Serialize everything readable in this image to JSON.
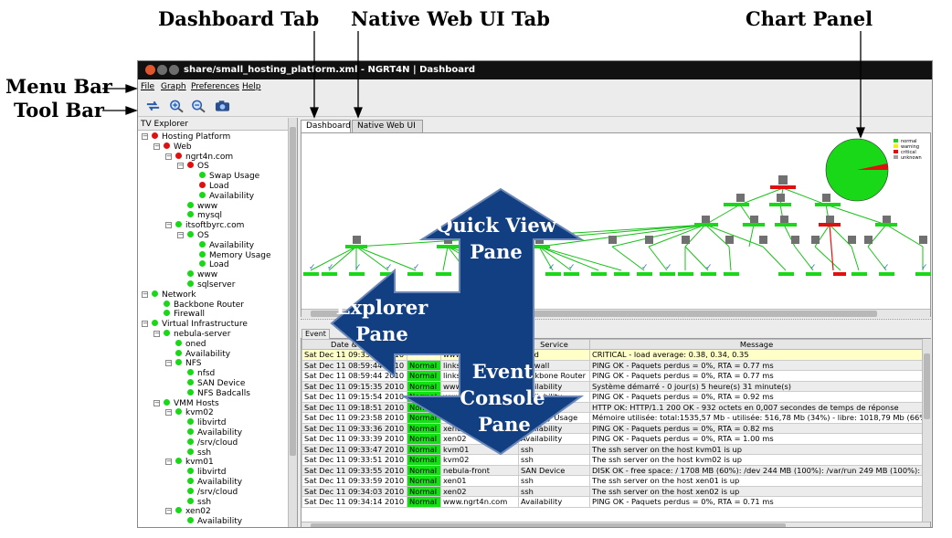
{
  "callouts": {
    "dashboard_tab": "Dashboard Tab",
    "native_tab": "Native Web UI Tab",
    "chart_panel": "Chart Panel",
    "menu_bar": "Menu Bar",
    "tool_bar": "Tool Bar",
    "quick_view": [
      "Quick View",
      "Pane"
    ],
    "explorer": [
      "Explorer",
      "Pane"
    ],
    "event_console": [
      "Event",
      "Console",
      "Pane"
    ]
  },
  "window": {
    "title": "share/small_hosting_platform.xml - NGRT4N | Dashboard"
  },
  "menu": [
    "File",
    "Graph",
    "Preferences",
    "Help"
  ],
  "toolbar_icons": [
    "refresh-icon",
    "zoom-in-icon",
    "zoom-out-icon",
    "camera-icon"
  ],
  "explorer": {
    "title": "TV Explorer",
    "tree": [
      {
        "label": "Hosting Platform",
        "level": 0,
        "status": "critical"
      },
      {
        "label": "Web",
        "level": 1,
        "status": "critical"
      },
      {
        "label": "ngrt4n.com",
        "level": 2,
        "status": "critical"
      },
      {
        "label": "OS",
        "level": 3,
        "status": "critical"
      },
      {
        "label": "Swap Usage",
        "level": 4,
        "status": "normal"
      },
      {
        "label": "Load",
        "level": 4,
        "status": "critical"
      },
      {
        "label": "Availability",
        "level": 4,
        "status": "normal"
      },
      {
        "label": "www",
        "level": 3,
        "status": "normal"
      },
      {
        "label": "mysql",
        "level": 3,
        "status": "normal"
      },
      {
        "label": "itsoftbyrc.com",
        "level": 2,
        "status": "normal"
      },
      {
        "label": "OS",
        "level": 3,
        "status": "normal"
      },
      {
        "label": "Availability",
        "level": 4,
        "status": "normal"
      },
      {
        "label": "Memory Usage",
        "level": 4,
        "status": "normal"
      },
      {
        "label": "Load",
        "level": 4,
        "status": "normal"
      },
      {
        "label": "www",
        "level": 3,
        "status": "normal"
      },
      {
        "label": "sqlserver",
        "level": 3,
        "status": "normal"
      },
      {
        "label": "Network",
        "level": 0,
        "status": "normal"
      },
      {
        "label": "Backbone Router",
        "level": 1,
        "status": "normal"
      },
      {
        "label": "Firewall",
        "level": 1,
        "status": "normal"
      },
      {
        "label": "Virtual Infrastructure",
        "level": 0,
        "status": "normal"
      },
      {
        "label": "nebula-server",
        "level": 1,
        "status": "normal"
      },
      {
        "label": "oned",
        "level": 2,
        "status": "normal"
      },
      {
        "label": "Availability",
        "level": 2,
        "status": "normal"
      },
      {
        "label": "NFS",
        "level": 2,
        "status": "normal"
      },
      {
        "label": "nfsd",
        "level": 3,
        "status": "normal"
      },
      {
        "label": "SAN Device",
        "level": 3,
        "status": "normal"
      },
      {
        "label": "NFS Badcalls",
        "level": 3,
        "status": "normal"
      },
      {
        "label": "VMM Hosts",
        "level": 1,
        "status": "normal"
      },
      {
        "label": "kvm02",
        "level": 2,
        "status": "normal"
      },
      {
        "label": "libvirtd",
        "level": 3,
        "status": "normal"
      },
      {
        "label": "Availability",
        "level": 3,
        "status": "normal"
      },
      {
        "label": "/srv/cloud",
        "level": 3,
        "status": "normal"
      },
      {
        "label": "ssh",
        "level": 3,
        "status": "normal"
      },
      {
        "label": "kvm01",
        "level": 2,
        "status": "normal"
      },
      {
        "label": "libvirtd",
        "level": 3,
        "status": "normal"
      },
      {
        "label": "Availability",
        "level": 3,
        "status": "normal"
      },
      {
        "label": "/srv/cloud",
        "level": 3,
        "status": "normal"
      },
      {
        "label": "ssh",
        "level": 3,
        "status": "normal"
      },
      {
        "label": "xen02",
        "level": 2,
        "status": "normal"
      },
      {
        "label": "Availability",
        "level": 3,
        "status": "normal"
      }
    ]
  },
  "tabs": [
    "Dashboard",
    "Native Web UI"
  ],
  "chart_legend": [
    "normal",
    "warning",
    "critical",
    "unknown"
  ],
  "status_colors": {
    "normal": "#18d818",
    "warning": "#f2f200",
    "critical": "#e01010",
    "unknown": "#a0a0a0"
  },
  "console": {
    "tab": "Event",
    "columns": [
      "Date & Time",
      "Status",
      "Host",
      "Service",
      "Message"
    ],
    "rows": [
      {
        "date": "Sat Dec 11 09:33:52 2010",
        "status": "Critical",
        "host": "www.ngrt4n.com",
        "service": "Load",
        "message": "CRITICAL - load average: 0.38, 0.34, 0.35"
      },
      {
        "date": "Sat Dec 11 08:59:44 2010",
        "status": "Normal",
        "host": "linksys",
        "service": "Firewall",
        "message": "PING OK - Paquets perdus = 0%, RTA = 0.77 ms"
      },
      {
        "date": "Sat Dec 11 08:59:44 2010",
        "status": "Normal",
        "host": "linksys",
        "service": "Backbone Router",
        "message": "PING OK - Paquets perdus = 0%, RTA = 0.77 ms"
      },
      {
        "date": "Sat Dec 11 09:15:35 2010",
        "status": "Normal",
        "host": "www.itsoftbyrc.com",
        "service": "Availability",
        "message": "Système démarré - 0 jour(s) 5 heure(s) 31 minute(s)"
      },
      {
        "date": "Sat Dec 11 09:15:54 2010",
        "status": "Normal",
        "host": "www.itsoftbyrc.com",
        "service": "Availability",
        "message": "PING OK - Paquets perdus = 0%, RTA = 0.92 ms"
      },
      {
        "date": "Sat Dec 11 09:18:51 2010",
        "status": "Normal",
        "host": "www.itsoftbyrc.com",
        "service": "www",
        "message": "HTTP OK: HTTP/1.1 200 OK - 932 octets en 0,007 secondes de temps de réponse"
      },
      {
        "date": "Sat Dec 11 09:23:58 2010",
        "status": "Normal",
        "host": "www.itsoftbyrc.com",
        "service": "Memory Usage",
        "message": "Mémoire utilisée: total:1535,57 Mb - utilisée: 516,78 Mb (34%) - libre: 1018,79 Mb (66%)"
      },
      {
        "date": "Sat Dec 11 09:33:36 2010",
        "status": "Normal",
        "host": "xen01",
        "service": "Availability",
        "message": "PING OK - Paquets perdus = 0%, RTA = 0.82 ms"
      },
      {
        "date": "Sat Dec 11 09:33:39 2010",
        "status": "Normal",
        "host": "xen02",
        "service": "Availability",
        "message": "PING OK - Paquets perdus = 0%, RTA = 1.00 ms"
      },
      {
        "date": "Sat Dec 11 09:33:47 2010",
        "status": "Normal",
        "host": "kvm01",
        "service": "ssh",
        "message": "The ssh server on the host kvm01 is up"
      },
      {
        "date": "Sat Dec 11 09:33:51 2010",
        "status": "Normal",
        "host": "kvm02",
        "service": "ssh",
        "message": "The ssh server on the host kvm02 is up"
      },
      {
        "date": "Sat Dec 11 09:33:55 2010",
        "status": "Normal",
        "host": "nebula-front",
        "service": "SAN Device",
        "message": "DISK OK - free space: / 1708 MB (60%): /dev 244 MB (100%): /var/run 249 MB (100%):"
      },
      {
        "date": "Sat Dec 11 09:33:59 2010",
        "status": "Normal",
        "host": "xen01",
        "service": "ssh",
        "message": "The ssh server on the host xen01 is up"
      },
      {
        "date": "Sat Dec 11 09:34:03 2010",
        "status": "Normal",
        "host": "xen02",
        "service": "ssh",
        "message": "The ssh server on the host xen02 is up"
      },
      {
        "date": "Sat Dec 11 09:34:14 2010",
        "status": "Normal",
        "host": "www.ngrt4n.com",
        "service": "Availability",
        "message": "PING OK - Paquets perdus = 0%, RTA = 0.71 ms"
      }
    ]
  }
}
